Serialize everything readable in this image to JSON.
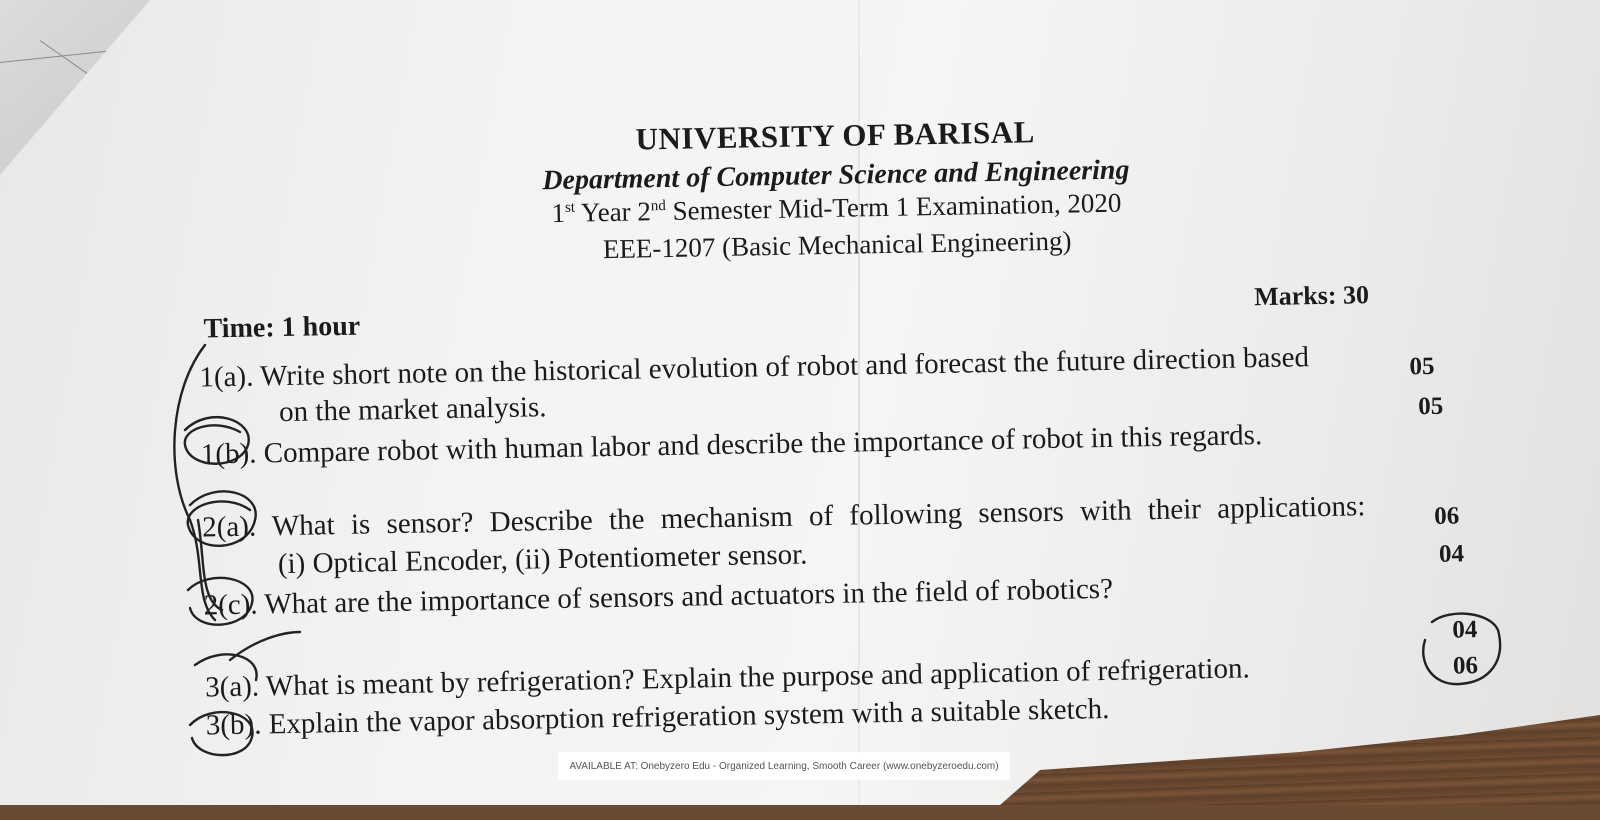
{
  "header": {
    "university": "UNIVERSITY OF BARISAL",
    "department": "Department of Computer Science and Engineering",
    "exam_year_num": "1",
    "exam_year_sup": "st",
    "exam_year_word": "Year",
    "exam_sem_num": "2",
    "exam_sem_sup": "nd",
    "exam_rest": "Semester Mid-Term 1 Examination, 2020",
    "course": "EEE-1207 (Basic Mechanical Engineering)"
  },
  "meta": {
    "time": "Time: 1 hour",
    "marks": "Marks: 30"
  },
  "questions": [
    {
      "num": "1(a).",
      "line1": "Write short note on the historical evolution of robot and forecast the future direction based",
      "line2": "on the market analysis.",
      "marks": "05"
    },
    {
      "num": "1(b).",
      "line1": "Compare robot with human labor and describe the importance of robot in this regards.",
      "marks": "05"
    },
    {
      "num": "2(a).",
      "line1": "What is sensor? Describe the mechanism of following sensors with their applications:",
      "line2": "(i) Optical Encoder, (ii) Potentiometer sensor.",
      "marks": "06"
    },
    {
      "num": "2(c).",
      "line1": "What are the importance of sensors and actuators in the field of robotics?",
      "marks": "04"
    },
    {
      "num": "3(a).",
      "line1": "What is meant by refrigeration? Explain the purpose and application of refrigeration.",
      "marks": "04"
    },
    {
      "num": "3(b).",
      "line1": "Explain the vapor absorption refrigeration system with a suitable sketch.",
      "marks": "06"
    }
  ],
  "watermark": "AVAILABLE AT: Onebyzero Edu - Organized Learning, Smooth Career (www.onebyzeroedu.com)"
}
